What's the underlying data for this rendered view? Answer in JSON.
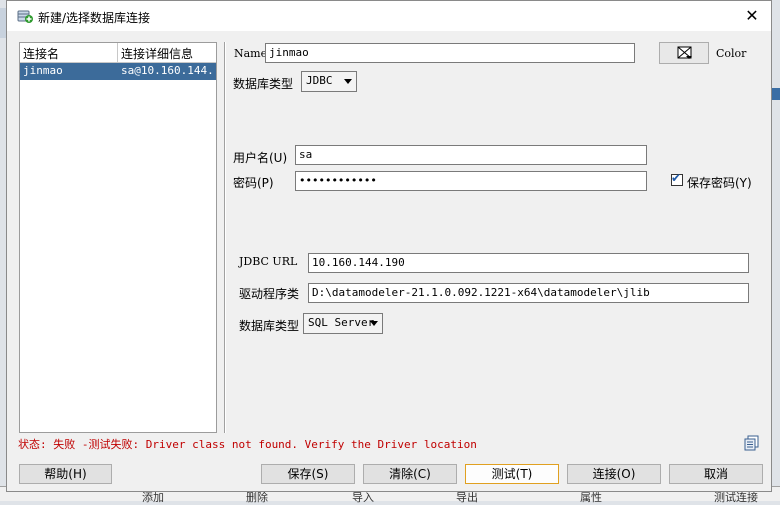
{
  "window": {
    "title": "新建/选择数据库连接",
    "close": "✕"
  },
  "connections": {
    "columns": [
      "连接名",
      "连接详细信息"
    ],
    "rows": [
      {
        "name": "jinmao",
        "details": "sa@10.160.144..."
      }
    ]
  },
  "form": {
    "name_label": "Name",
    "name_value": "jinmao",
    "color_label": "Color",
    "db_type_label": "数据库类型",
    "db_type_value": "JDBC",
    "username_label": "用户名(U)",
    "username_value": "sa",
    "password_label": "密码(P)",
    "password_value": "••••••••••••",
    "save_password_label": "保存密码(Y)",
    "save_password_checked": true,
    "jdbc_url_label": "JDBC URL",
    "jdbc_url_value": "10.160.144.190",
    "driver_label": "驱动程序类",
    "driver_value": "D:\\datamodeler-21.1.0.092.1221-x64\\datamodeler\\jlib",
    "db_type2_label": "数据库类型",
    "db_type2_value": "SQL Server"
  },
  "status": {
    "text": "状态: 失败 -测试失败: Driver class not found. Verify the Driver location"
  },
  "buttons": {
    "help": "帮助(H)",
    "save": "保存(S)",
    "clear": "清除(C)",
    "test": "测试(T)",
    "connect": "连接(O)",
    "cancel": "取消"
  },
  "background": {
    "bottom_labels": [
      "添加",
      "删除",
      "导入",
      "导出",
      "属性",
      "测试连接"
    ]
  },
  "icons": {
    "title_icon": "database-add-icon",
    "color_icon": "color-picker-icon",
    "log_icon": "copy-log-icon"
  },
  "colors": {
    "selection": "#3c6b9a",
    "error_text": "#c00000",
    "focus_border": "#e0a020"
  }
}
